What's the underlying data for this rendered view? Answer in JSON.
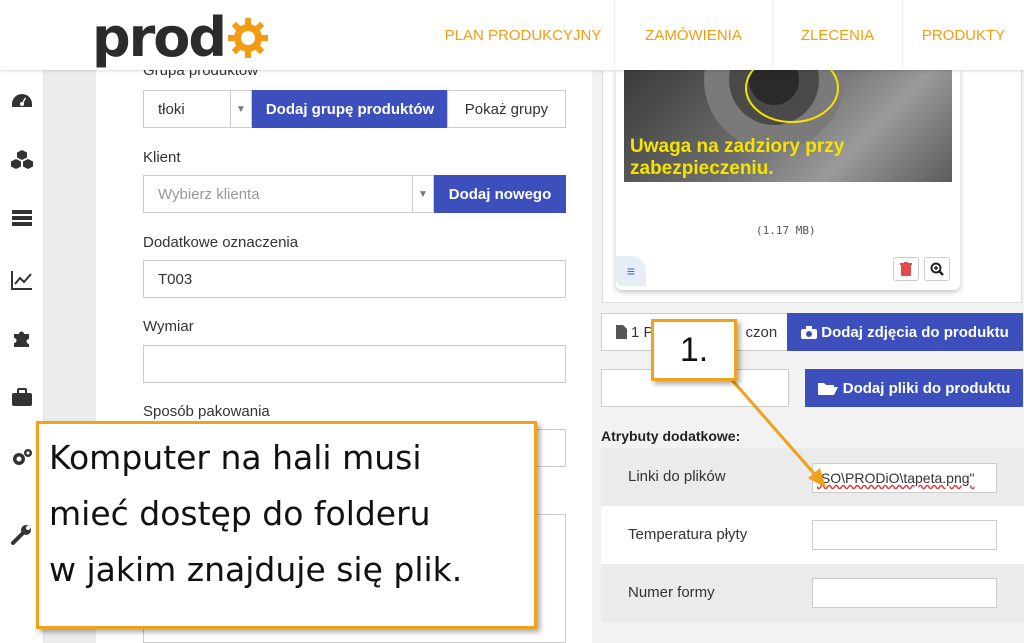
{
  "logo": {
    "text": "prod"
  },
  "nav": {
    "items": [
      {
        "label": "PLAN PRODUKCYJNY"
      },
      {
        "label": "ZAMÓWIENIA"
      },
      {
        "label": "ZLECENIA"
      },
      {
        "label": "PRODUKTY"
      }
    ]
  },
  "sidebar": {
    "icons": [
      "dashboard-icon",
      "cubes-icon",
      "list-icon",
      "chart-line-icon",
      "puzzle-icon",
      "briefcase-icon",
      "gears-icon",
      "wrench-icon"
    ]
  },
  "form": {
    "group_label": "Grupa produktów",
    "group_value": "tłoki",
    "add_group_button": "Dodaj grupę produktów",
    "show_groups_button": "Pokaż grupy",
    "client_label": "Klient",
    "client_placeholder": "Wybierz klienta",
    "add_client_button": "Dodaj nowego",
    "extra_label": "Dodatkowe oznaczenia",
    "extra_value": "T003",
    "dimension_label": "Wymiar",
    "dimension_value": "",
    "packing_label": "Sposób pakowania"
  },
  "image": {
    "caption": "Uwaga na zadziory przy zabezpieczeniu.",
    "filesize": "(1.17 MB)"
  },
  "files": {
    "photos_count": "1 P",
    "photos_suffix": "czon",
    "add_photos_button": "Dodaj zdjęcia do produktu",
    "add_files_button": "Dodaj pliki do produktu"
  },
  "attributes": {
    "title": "Atrybuty dodatkowe:",
    "rows": [
      {
        "label": "Linki do plików",
        "value": "ISO\\PRODiO\\tapeta.png\""
      },
      {
        "label": "Temperatura płyty",
        "value": ""
      },
      {
        "label": "Numer formy",
        "value": ""
      }
    ]
  },
  "callouts": {
    "main_line1": "Komputer na hali musi",
    "main_line2": "mieć dostęp do folderu",
    "main_line3": "w jakim znajduje się plik.",
    "step": "1."
  },
  "colors": {
    "accent_orange": "#f39c12",
    "button_blue": "#3c4fbd",
    "callout_border": "#f0a21a"
  }
}
